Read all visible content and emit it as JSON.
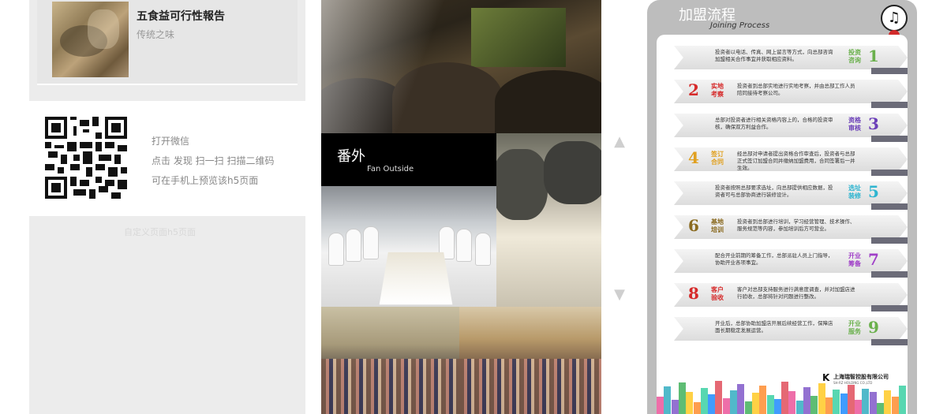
{
  "article": {
    "title": "五食益可行性報告",
    "subtitle": "传统之味"
  },
  "qr": {
    "line1": "打开微信",
    "line2": "点击 发现 扫一扫 扫描二维码",
    "line3": "可在手机上预览该h5页面"
  },
  "faded_label": "自定义页面h5页面",
  "gallery": {
    "fan_title": "番外",
    "fan_subtitle": "Fan Outside"
  },
  "nav": {
    "up_icon": "▲",
    "down_icon": "▼"
  },
  "process": {
    "title": "加盟流程",
    "subtitle": "Joining Process",
    "music_icon": "♫",
    "company": "上海瑞智控股有限公司",
    "company_sub": "SH-RZ HOLDING CO.,LTD",
    "company_logo": "K",
    "steps": [
      {
        "num": "1",
        "label": "投资\n咨询",
        "text": "投资者以电话、传真、网上留言等方式，向总部咨询加盟相关合作事宜并获取相应资料。",
        "color": "#6ab04c"
      },
      {
        "num": "2",
        "label": "实地\n考察",
        "text": "投资者到总部实地进行实地考察，并由总部工作人员陪同接待考察公司。",
        "color": "#d62a2a"
      },
      {
        "num": "3",
        "label": "资格\n审核",
        "text": "总部对投资者进行相关资格内容上的，合格的投资审核，确保双方利益合作。",
        "color": "#6b3fb8"
      },
      {
        "num": "4",
        "label": "签订\n合同",
        "text": "经总部对申请者提出资格合作审查后，投资者与总部正式签订加盟合同并缴纳加盟费用，合同签署后一并生效。",
        "color": "#e0a020"
      },
      {
        "num": "5",
        "label": "选址\n装修",
        "text": "投资者按照总部要求选址，向总部提供相应数据，投资者可与总部协商进行装修设计。",
        "color": "#2fb5d0"
      },
      {
        "num": "6",
        "label": "基地\n培训",
        "text": "投资者到总部进行培训，学习经营管理、技术操作、服务规范等内容，参加培训后方可营业。",
        "color": "#8a6a20"
      },
      {
        "num": "7",
        "label": "开业\n筹备",
        "text": "配合开业前期的筹备工作，总部派驻人员上门指导，协助开业各项事宜。",
        "color": "#a040c8"
      },
      {
        "num": "8",
        "label": "客户\n验收",
        "text": "客户对总部支持服务进行满意度调查，并对加盟店进行验收，总部将针对问题进行整改。",
        "color": "#d62a2a"
      },
      {
        "num": "9",
        "label": "开业\n服务",
        "text": "开业后，总部协助加盟店开展后续经营工作，保障店面长期稳定发展运营。",
        "color": "#6ab04c"
      }
    ]
  }
}
